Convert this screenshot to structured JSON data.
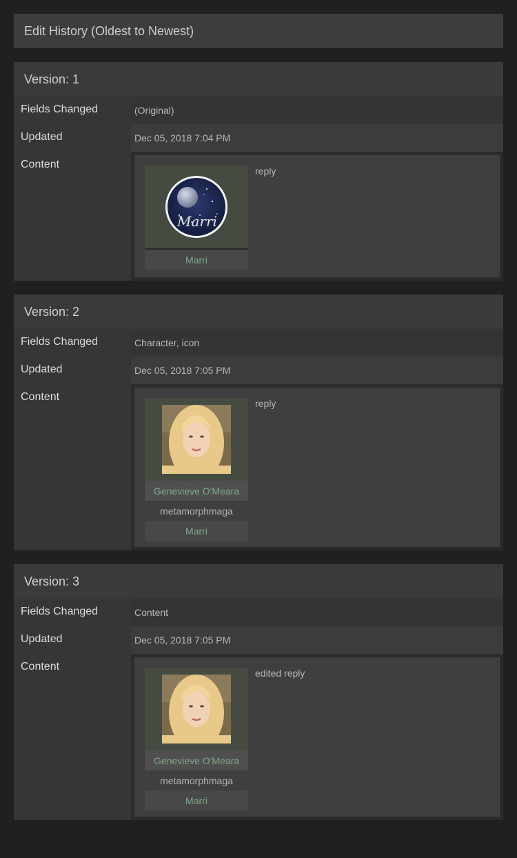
{
  "page_title": "Edit History (Oldest to Newest)",
  "labels": {
    "fields_changed": "Fields Changed",
    "updated": "Updated",
    "content": "Content"
  },
  "versions": [
    {
      "title": "Version: 1",
      "fields_changed": "(Original)",
      "updated": "Dec 05, 2018 7:04 PM",
      "text": "reply",
      "icon": "moon-avatar-icon",
      "username": "Marri"
    },
    {
      "title": "Version: 2",
      "fields_changed": "Character, icon",
      "updated": "Dec 05, 2018 7:05 PM",
      "text": "reply",
      "icon": "blonde-portrait-icon",
      "character": "Genevieve O'Meara",
      "screenname": "metamorphmaga",
      "username": "Marri"
    },
    {
      "title": "Version: 3",
      "fields_changed": "Content",
      "updated": "Dec 05, 2018 7:05 PM",
      "text": "edited reply",
      "icon": "blonde-portrait-icon",
      "character": "Genevieve O'Meara",
      "screenname": "metamorphmaga",
      "username": "Marri"
    }
  ],
  "colors": {
    "background": "#202020",
    "link": "#7fa88a"
  }
}
